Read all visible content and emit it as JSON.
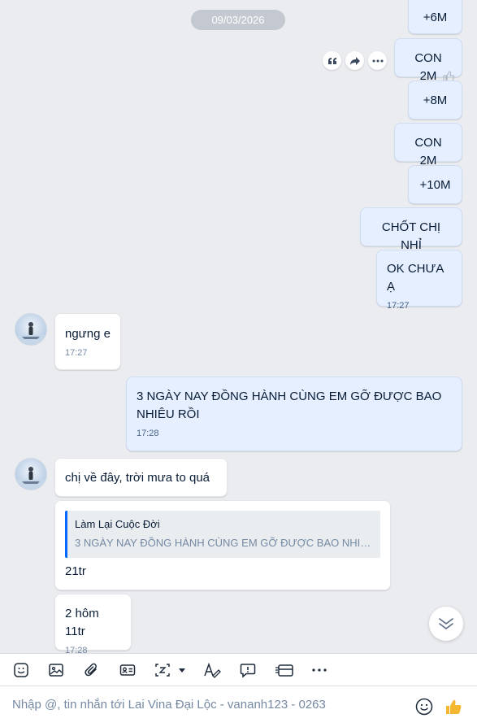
{
  "conversation": {
    "date_separator": "09/03/2026",
    "contact_name": "Lai Vina Đại Lộc - vananh123 - 0263"
  },
  "messages": [
    {
      "from": "me",
      "text": "+6M"
    },
    {
      "from": "me",
      "text": "CON 2M"
    },
    {
      "from": "me",
      "text": "+8M"
    },
    {
      "from": "me",
      "text": "CON 2M"
    },
    {
      "from": "me",
      "text": "+10M"
    },
    {
      "from": "me",
      "text": "CHỐT CHỊ NHỈ"
    },
    {
      "from": "me",
      "text": "OK CHƯA Ạ",
      "time": "17:27"
    },
    {
      "from": "them",
      "text": "ngưng e",
      "time": "17:27"
    },
    {
      "from": "me",
      "text": "3 NGÀY NAY ĐỒNG HÀNH CÙNG EM GỠ ĐƯỢC BAO NHIÊU RỒI",
      "time": "17:28"
    },
    {
      "from": "them",
      "text": "chị về đây, trời mưa to quá"
    },
    {
      "from": "them",
      "quote": {
        "author": "Làm Lại Cuộc Đời",
        "text": "3 NGÀY NAY ĐỒNG HÀNH CÙNG EM GỠ ĐƯỢC BAO NHIÊU ..."
      },
      "text": "21tr"
    },
    {
      "from": "them",
      "text": "2 hôm 11tr",
      "time": "17:28"
    }
  ],
  "message_actions": [
    "quote-icon",
    "forward-icon",
    "more-icon"
  ],
  "toolbar": {
    "tools": [
      "sticker-icon",
      "image-icon",
      "attachment-icon",
      "contact-card-icon",
      "screenshot-icon",
      "format-text-icon",
      "quick-message-icon",
      "task-icon",
      "more-icon"
    ]
  },
  "composer": {
    "placeholder": "Nhập @, tin nhắn tới Lai Vina Đại Lộc - vananh123 - 0263"
  },
  "colors": {
    "chat_background": "#ebecf0",
    "my_bubble": "#e5efff",
    "their_bubble": "#ffffff",
    "quote_accent": "#0068ff",
    "like_icon": "#f5b731"
  }
}
